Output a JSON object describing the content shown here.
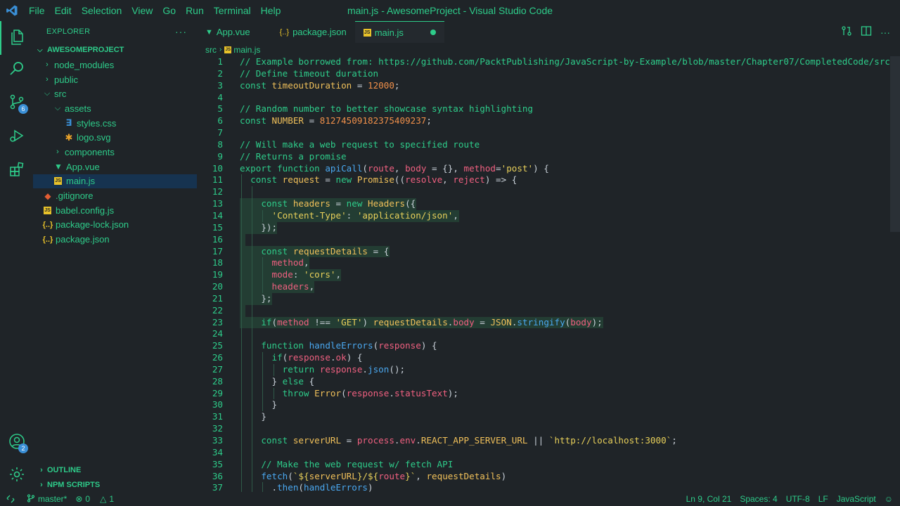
{
  "window_title": "main.js - AwesomeProject - Visual Studio Code",
  "menu": [
    "File",
    "Edit",
    "Selection",
    "View",
    "Go",
    "Run",
    "Terminal",
    "Help"
  ],
  "activity": {
    "source_control_badge": "6",
    "accounts_badge": "2"
  },
  "sidebar": {
    "title": "EXPLORER",
    "more": "···",
    "project": "AWESOMEPROJECT",
    "tree": [
      {
        "label": "node_modules",
        "depth": 0,
        "kind": "folder",
        "open": false
      },
      {
        "label": "public",
        "depth": 0,
        "kind": "folder",
        "open": false
      },
      {
        "label": "src",
        "depth": 0,
        "kind": "folder",
        "open": true
      },
      {
        "label": "assets",
        "depth": 1,
        "kind": "folder",
        "open": true
      },
      {
        "label": "styles.css",
        "depth": 2,
        "kind": "css"
      },
      {
        "label": "logo.svg",
        "depth": 2,
        "kind": "svg"
      },
      {
        "label": "components",
        "depth": 1,
        "kind": "folder",
        "open": false
      },
      {
        "label": "App.vue",
        "depth": 1,
        "kind": "vue"
      },
      {
        "label": "main.js",
        "depth": 1,
        "kind": "js",
        "selected": true
      },
      {
        "label": ".gitignore",
        "depth": 0,
        "kind": "git"
      },
      {
        "label": "babel.config.js",
        "depth": 0,
        "kind": "js"
      },
      {
        "label": "package-lock.json",
        "depth": 0,
        "kind": "json"
      },
      {
        "label": "package.json",
        "depth": 0,
        "kind": "json"
      }
    ],
    "outline": "OUTLINE",
    "npm_scripts": "NPM SCRIPTS"
  },
  "tabs": [
    {
      "label": "App.vue",
      "icon": "vue",
      "active": false
    },
    {
      "label": "package.json",
      "icon": "json",
      "active": false
    },
    {
      "label": "main.js",
      "icon": "js",
      "active": true,
      "dirty": true
    }
  ],
  "breadcrumb": {
    "folder": "src",
    "file": "main.js"
  },
  "code_lines": [
    [
      [
        "c",
        "// Example borrowed from: https://github.com/PacktPublishing/JavaScript-by-Example/blob/master/Chapter07/CompletedCode/src/se"
      ]
    ],
    [
      [
        "c",
        "// Define timeout duration"
      ]
    ],
    [
      [
        "k",
        "const "
      ],
      [
        "v",
        "timeoutDuration"
      ],
      [
        "o",
        " = "
      ],
      [
        "n",
        "12000"
      ],
      [
        "o",
        ";"
      ]
    ],
    [],
    [
      [
        "c",
        "// Random number to better showcase syntax highlighting"
      ]
    ],
    [
      [
        "k",
        "const "
      ],
      [
        "v",
        "NUMBER"
      ],
      [
        "o",
        " = "
      ],
      [
        "n",
        "81274509182375409237"
      ],
      [
        "o",
        ";"
      ]
    ],
    [],
    [
      [
        "c",
        "// Will make a web request to specified route"
      ]
    ],
    [
      [
        "c",
        "// Returns a promise"
      ]
    ],
    [
      [
        "k",
        "export function "
      ],
      [
        "f",
        "apiCall"
      ],
      [
        "o",
        "("
      ],
      [
        "p",
        "route"
      ],
      [
        "o",
        ", "
      ],
      [
        "p",
        "body"
      ],
      [
        "o",
        " = {}, "
      ],
      [
        "p",
        "method"
      ],
      [
        "o",
        "="
      ],
      [
        "s",
        "'post'"
      ],
      [
        "o",
        ") {"
      ]
    ],
    [
      [
        "o",
        "  "
      ],
      [
        "k",
        "const "
      ],
      [
        "v",
        "request"
      ],
      [
        "o",
        " = "
      ],
      [
        "k",
        "new "
      ],
      [
        "v",
        "Promise"
      ],
      [
        "o",
        "(("
      ],
      [
        "p",
        "resolve"
      ],
      [
        "o",
        ", "
      ],
      [
        "p",
        "reject"
      ],
      [
        "o",
        ") => {"
      ]
    ],
    [],
    [
      [
        "o",
        "    "
      ],
      [
        "k",
        "const "
      ],
      [
        "v",
        "headers"
      ],
      [
        "o",
        " = "
      ],
      [
        "k",
        "new "
      ],
      [
        "v",
        "Headers"
      ],
      [
        "o",
        "({"
      ]
    ],
    [
      [
        "o",
        "      "
      ],
      [
        "s",
        "'Content-Type'"
      ],
      [
        "o",
        ": "
      ],
      [
        "s",
        "'application/json'"
      ],
      [
        "o",
        ","
      ]
    ],
    [
      [
        "o",
        "    });"
      ]
    ],
    [],
    [
      [
        "o",
        "    "
      ],
      [
        "k",
        "const "
      ],
      [
        "v",
        "requestDetails"
      ],
      [
        "o",
        " = {"
      ]
    ],
    [
      [
        "o",
        "      "
      ],
      [
        "p",
        "method"
      ],
      [
        "o",
        ","
      ]
    ],
    [
      [
        "o",
        "      "
      ],
      [
        "p",
        "mode"
      ],
      [
        "o",
        ": "
      ],
      [
        "s",
        "'cors'"
      ],
      [
        "o",
        ","
      ]
    ],
    [
      [
        "o",
        "      "
      ],
      [
        "p",
        "headers"
      ],
      [
        "o",
        ","
      ]
    ],
    [
      [
        "o",
        "    };"
      ]
    ],
    [],
    [
      [
        "o",
        "    "
      ],
      [
        "k",
        "if"
      ],
      [
        "o",
        "("
      ],
      [
        "p",
        "method"
      ],
      [
        "o",
        " !== "
      ],
      [
        "s",
        "'GET'"
      ],
      [
        "o",
        ") "
      ],
      [
        "v",
        "requestDetails"
      ],
      [
        "o",
        "."
      ],
      [
        "p",
        "body"
      ],
      [
        "o",
        " = "
      ],
      [
        "v",
        "JSON"
      ],
      [
        "o",
        "."
      ],
      [
        "f",
        "stringify"
      ],
      [
        "o",
        "("
      ],
      [
        "p",
        "body"
      ],
      [
        "o",
        ");"
      ]
    ],
    [],
    [
      [
        "o",
        "    "
      ],
      [
        "k",
        "function "
      ],
      [
        "f",
        "handleErrors"
      ],
      [
        "o",
        "("
      ],
      [
        "p",
        "response"
      ],
      [
        "o",
        ") {"
      ]
    ],
    [
      [
        "o",
        "      "
      ],
      [
        "k",
        "if"
      ],
      [
        "o",
        "("
      ],
      [
        "p",
        "response"
      ],
      [
        "o",
        "."
      ],
      [
        "p",
        "ok"
      ],
      [
        "o",
        ") {"
      ]
    ],
    [
      [
        "o",
        "        "
      ],
      [
        "k",
        "return "
      ],
      [
        "p",
        "response"
      ],
      [
        "o",
        "."
      ],
      [
        "f",
        "json"
      ],
      [
        "o",
        "();"
      ]
    ],
    [
      [
        "o",
        "      } "
      ],
      [
        "k",
        "else "
      ],
      [
        "o",
        "{"
      ]
    ],
    [
      [
        "o",
        "        "
      ],
      [
        "k",
        "throw "
      ],
      [
        "v",
        "Error"
      ],
      [
        "o",
        "("
      ],
      [
        "p",
        "response"
      ],
      [
        "o",
        "."
      ],
      [
        "p",
        "statusText"
      ],
      [
        "o",
        ");"
      ]
    ],
    [
      [
        "o",
        "      }"
      ]
    ],
    [
      [
        "o",
        "    }"
      ]
    ],
    [],
    [
      [
        "o",
        "    "
      ],
      [
        "k",
        "const "
      ],
      [
        "v",
        "serverURL"
      ],
      [
        "o",
        " = "
      ],
      [
        "p",
        "process"
      ],
      [
        "o",
        "."
      ],
      [
        "p",
        "env"
      ],
      [
        "o",
        "."
      ],
      [
        "v",
        "REACT_APP_SERVER_URL"
      ],
      [
        "o",
        " || "
      ],
      [
        "s",
        "`http://localhost:3000`"
      ],
      [
        "o",
        ";"
      ]
    ],
    [],
    [
      [
        "o",
        "    "
      ],
      [
        "c",
        "// Make the web request w/ fetch API"
      ]
    ],
    [
      [
        "o",
        "    "
      ],
      [
        "f",
        "fetch"
      ],
      [
        "o",
        "("
      ],
      [
        "s",
        "`${"
      ],
      [
        "v",
        "serverURL"
      ],
      [
        "s",
        "}/${"
      ],
      [
        "p",
        "route"
      ],
      [
        "s",
        "}`"
      ],
      [
        "o",
        ", "
      ],
      [
        "v",
        "requestDetails"
      ],
      [
        "o",
        ")"
      ]
    ],
    [
      [
        "o",
        "      ."
      ],
      [
        "f",
        "then"
      ],
      [
        "o",
        "("
      ],
      [
        "f",
        "handleErrors"
      ],
      [
        "o",
        ")"
      ]
    ]
  ],
  "status": {
    "branch": "master*",
    "errors": "0",
    "warnings": "1",
    "position": "Ln 9, Col 21",
    "spaces": "Spaces: 4",
    "encoding": "UTF-8",
    "eol": "LF",
    "language": "JavaScript"
  },
  "colors": {
    "accent": "#2ecc8a",
    "background": "#1f2428",
    "selection": "#163350",
    "badge": "#3a8fd6"
  }
}
